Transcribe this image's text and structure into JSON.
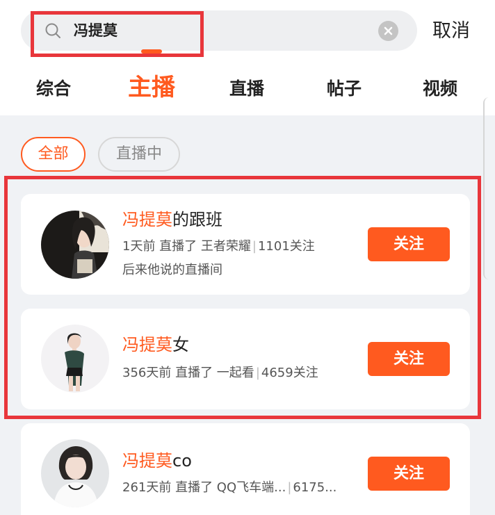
{
  "search": {
    "query": "冯提莫",
    "cancel_label": "取消"
  },
  "tabs": [
    {
      "label": "综合",
      "active": false
    },
    {
      "label": "主播",
      "active": true
    },
    {
      "label": "直播",
      "active": false
    },
    {
      "label": "帖子",
      "active": false
    },
    {
      "label": "视频",
      "active": false
    }
  ],
  "filters": [
    {
      "label": "全部",
      "selected": true
    },
    {
      "label": "直播中",
      "selected": false
    }
  ],
  "results": [
    {
      "name_highlight": "冯提莫",
      "name_rest": "的跟班",
      "last_live": "1天前 直播了 王者荣耀",
      "followers": "1101关注",
      "description": "后来他说的直播间",
      "follow_label": "关注"
    },
    {
      "name_highlight": "冯提莫",
      "name_rest": "女",
      "last_live": "356天前 直播了 一起看",
      "followers": "4659关注",
      "description": "",
      "follow_label": "关注"
    },
    {
      "name_highlight": "冯提莫",
      "name_rest": "co",
      "last_live": "261天前 直播了 QQ飞车端...",
      "followers": "6175...",
      "description": "",
      "follow_label": "关注"
    }
  ],
  "colors": {
    "accent": "#ff5a1f",
    "annotation_border": "#e8363b",
    "background": "#f0f2f5"
  }
}
